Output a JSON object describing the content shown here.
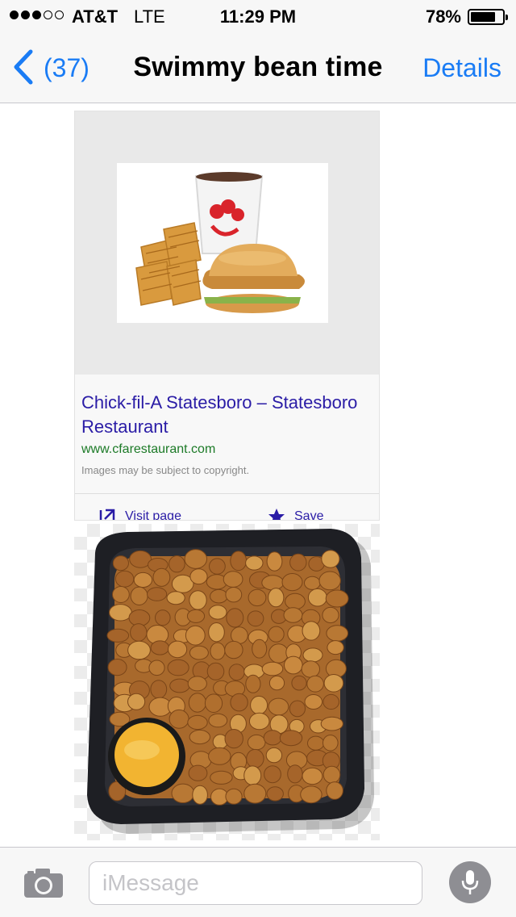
{
  "status_bar": {
    "signal_bars_filled": 3,
    "signal_bars_total": 5,
    "carrier": "AT&T",
    "network": "LTE",
    "time": "11:29 PM",
    "battery_percent": "78%",
    "battery_level": 0.78
  },
  "nav": {
    "back_icon": "chevron-left-icon",
    "back_count": "(37)",
    "title": "Swimmy bean time",
    "details_label": "Details"
  },
  "messages": [
    {
      "type": "link-card",
      "title": "Chick-fil-A Statesboro – Statesboro Restaurant",
      "url": "www.cfarestaurant.com",
      "note": "Images may be subject to copyright.",
      "actions": [
        "Visit page",
        "Save"
      ]
    },
    {
      "type": "image"
    }
  ],
  "input_bar": {
    "camera_icon": "camera-icon",
    "placeholder": "iMessage",
    "mic_icon": "microphone-icon"
  },
  "colors": {
    "accent": "#1a7cf5",
    "link": "#2a1ca6",
    "url": "#1c7a27",
    "bar_bg": "#f7f7f7"
  }
}
